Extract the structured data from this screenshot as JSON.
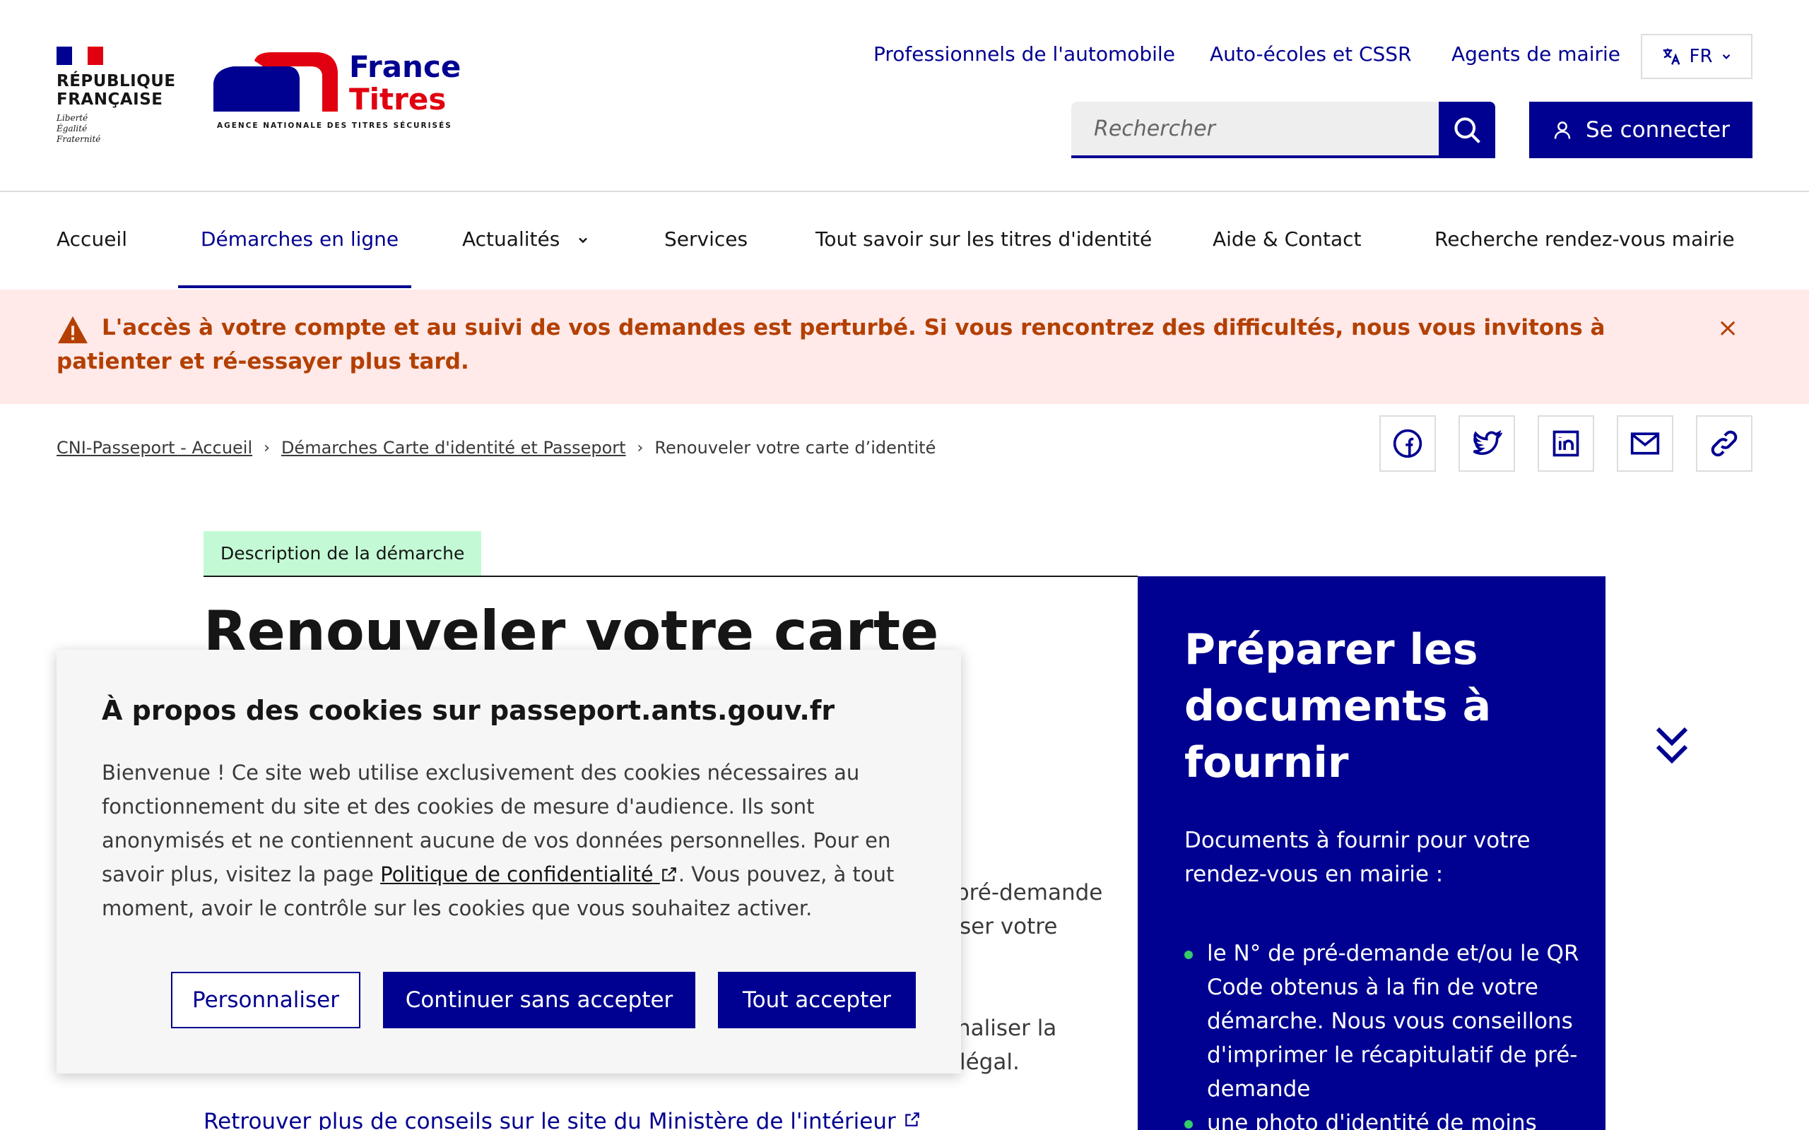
{
  "colors": {
    "primary": "#000091",
    "accent_red": "#e1000f",
    "alert_bg": "#ffe9e9",
    "alert_text": "#b34000",
    "tag_bg": "#c3fad5",
    "bullet": "#34cb6a"
  },
  "brand": {
    "rf_name_line1": "RÉPUBLIQUE",
    "rf_name_line2": "FRANÇAISE",
    "motto": [
      "Liberté",
      "Égalité",
      "Fraternité"
    ],
    "ft_name_line1": "France",
    "ft_name_line2": "Titres",
    "ft_tagline": "AGENCE NATIONALE DES TITRES SÉCURISÉS"
  },
  "header": {
    "links": [
      "Professionnels de l'automobile",
      "Auto-écoles et CSSR",
      "Agents de mairie"
    ],
    "lang": "FR",
    "search_placeholder": "Rechercher",
    "login_label": "Se connecter"
  },
  "nav": {
    "items": [
      "Accueil",
      "Démarches en ligne",
      "Actualités",
      "Services",
      "Tout savoir sur les titres d'identité",
      "Aide & Contact",
      "Recherche rendez-vous mairie"
    ],
    "active_index": 1
  },
  "alert": {
    "message": "L'accès à votre compte et au suivi de vos demandes est perturbé. Si vous rencontrez des difficultés, nous vous invitons à patienter et ré-essayer plus tard.",
    "close": "×"
  },
  "breadcrumb": [
    "CNI-Passeport - Accueil",
    "Démarches Carte d'identité et Passeport",
    "Renouveler votre carte d’identité"
  ],
  "share": [
    "facebook-icon",
    "twitter-icon",
    "linkedin-icon",
    "mail-icon",
    "link-icon"
  ],
  "main": {
    "tag": "Description de la démarche",
    "title": "Renouveler votre carte",
    "fragments": [
      "pré-demande",
      "ser votre",
      "naliser la",
      "légal."
    ],
    "bottom_link": "Retrouver plus de conseils sur le site du Ministère de l'intérieur"
  },
  "side": {
    "title": "Préparer les documents à fournir",
    "intro": "Documents à fournir pour votre rendez-vous en mairie :",
    "items": [
      "le N° de pré-demande et/ou le QR Code obtenus à la fin de votre démarche. Nous vous conseillons d'imprimer le récapitulatif de pré-demande",
      "une photo d'identité de moins"
    ]
  },
  "cookie": {
    "title": "À propos des cookies sur passeport.ants.gouv.fr",
    "text_before": "Bienvenue ! Ce site web utilise exclusivement des cookies nécessaires au fonctionnement du site et des cookies de mesure d'audience. Ils sont anonymisés et ne contiennent aucune de vos données personnelles. Pour en savoir plus, visitez la page ",
    "link": "Politique de confidentialité",
    "text_after": ". Vous pouvez, à tout moment, avoir le contrôle sur les cookies que vous souhaitez activer.",
    "btn_customize": "Personnaliser",
    "btn_continue": "Continuer sans accepter",
    "btn_accept": "Tout accepter"
  }
}
